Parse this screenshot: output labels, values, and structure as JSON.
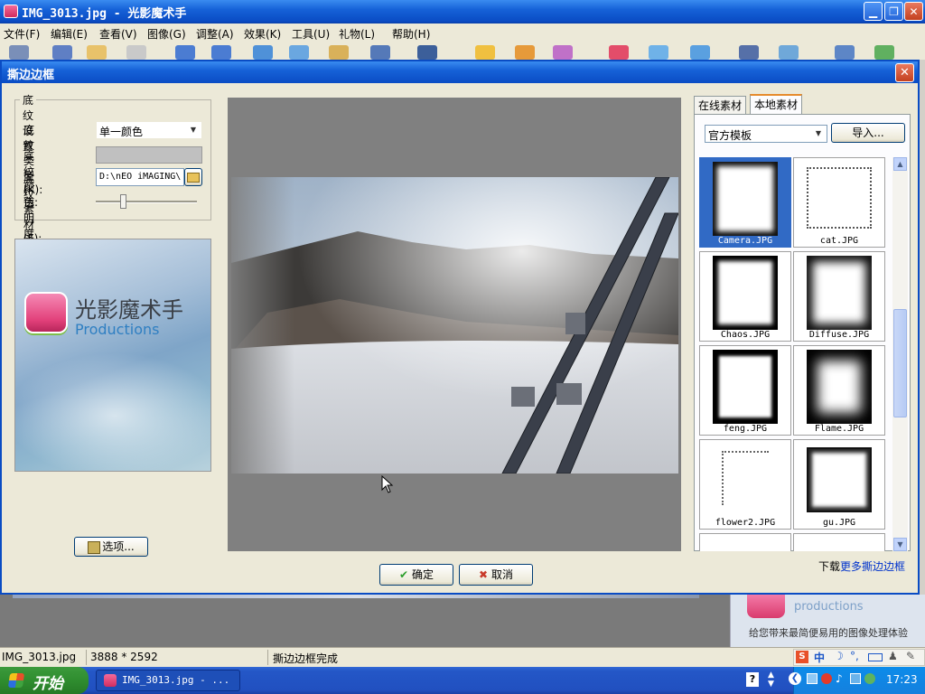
{
  "app": {
    "title": "IMG_3013.jpg - 光影魔术手",
    "menu": [
      "文件(F)",
      "编辑(E)",
      "查看(V)",
      "图像(G)",
      "调整(A)",
      "效果(K)",
      "工具(U)",
      "礼物(L)",
      "帮助(H)"
    ]
  },
  "dialog": {
    "title": "撕边边框",
    "group_title": "底纹设置",
    "texture_type_label": "底纹类型(K):",
    "texture_type_value": "单一颜色",
    "texture_color_label": "底纹颜色:",
    "texture_file_label": "底纹素材(F):",
    "texture_file_value": "D:\\nEO iMAGING\\",
    "opacity_label": "透明度(T):",
    "opacity_level": 0.26,
    "options_button": "选项...",
    "ok_button": "确定",
    "cancel_button": "取消",
    "logo": {
      "name": "光影魔术手",
      "sub": "Productions"
    }
  },
  "library": {
    "tabs": [
      "在线素材",
      "本地素材"
    ],
    "active_tab": 1,
    "category": "官方模板",
    "import_button": "导入...",
    "thumbnails": [
      "Camera.JPG",
      "cat.JPG",
      "Chaos.JPG",
      "Diffuse.JPG",
      "feng.JPG",
      "Flame.JPG",
      "flower2.JPG",
      "gu.JPG"
    ],
    "selected": 0,
    "download_prefix": "下载",
    "download_link": "更多撕边边框"
  },
  "background_ad": {
    "brand": "productions",
    "slogan": "给您带来最简便易用的图像处理体验"
  },
  "status": {
    "file": "IMG_3013.jpg",
    "size": "3888 * 2592",
    "message": "撕边边框完成"
  },
  "taskbar": {
    "start": "开始",
    "task": "IMG_3013.jpg - ...",
    "clock": "17:23",
    "ime": "中"
  },
  "colors": {
    "titlebar": "#0a4cc4",
    "selection": "#316ac5",
    "start_green": "#2f8d2f",
    "link": "#0033cc"
  }
}
